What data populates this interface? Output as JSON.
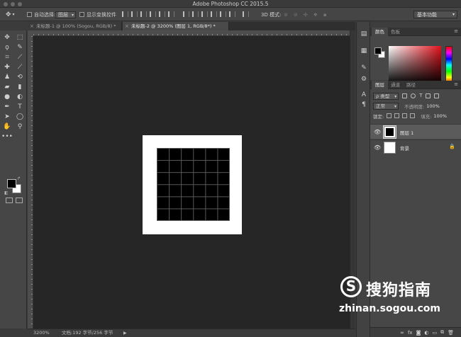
{
  "app": {
    "title": "Adobe Photoshop CC 2015.5"
  },
  "options_bar": {
    "auto_select_label": "自动选择:",
    "auto_select_value": "图层",
    "show_transform_label": "显示变换控件",
    "mode_3d": "3D 模式:",
    "workspace": "基本功能"
  },
  "tabs": [
    {
      "label": "未标题-1 @ 100% (Sogou, RGB/8) *",
      "close": "×"
    },
    {
      "label": "未标题-2 @ 3200% (图层 1, RGB/8*) *",
      "close": "×"
    }
  ],
  "status": {
    "zoom": "3200%",
    "doc_info": "文档:192 字节/256 字节",
    "arrow": "▶"
  },
  "color_panel": {
    "tabs": [
      "颜色",
      "色板"
    ],
    "fg": "#000000",
    "bg": "#ffffff"
  },
  "layers_panel": {
    "tabs": [
      "图层",
      "通道",
      "路径"
    ],
    "kind_label": "ρ 类型",
    "blend_mode": "正常",
    "opacity_label": "不透明度:",
    "opacity_value": "100%",
    "lock_label": "锁定:",
    "fill_label": "填充:",
    "fill_value": "100%",
    "layers": [
      {
        "name": "图层 1",
        "selected": true,
        "thumb": "black-square"
      },
      {
        "name": "背景",
        "selected": false,
        "thumb": "white",
        "locked": true
      }
    ],
    "footer_icons": [
      "link-icon",
      "fx-icon",
      "mask-icon",
      "adjustment-icon",
      "folder-icon",
      "new-layer-icon",
      "trash-icon"
    ]
  },
  "canvas": {
    "doc_bg": "#ffffff",
    "layer_fill": "#000000",
    "grid_cells": 6
  },
  "watermark": {
    "logo": "S",
    "cn": "搜狗指南",
    "url": "zhinan.sogou.com"
  }
}
